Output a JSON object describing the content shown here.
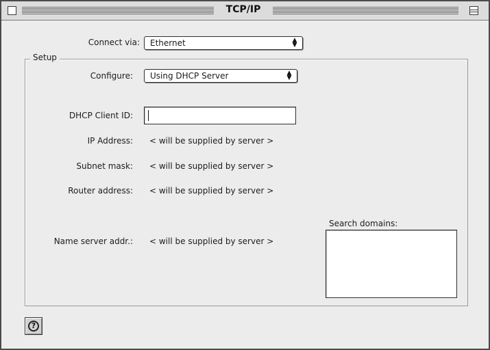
{
  "window": {
    "title": "TCP/IP"
  },
  "connect": {
    "label": "Connect via:",
    "value": "Ethernet"
  },
  "setup": {
    "group_label": "Setup",
    "configure_label": "Configure:",
    "configure_value": "Using DHCP Server",
    "dhcp_client_id_label": "DHCP Client ID:",
    "dhcp_client_id_value": "",
    "ip_address_label": "IP Address:",
    "ip_address_value": "< will be supplied by server >",
    "subnet_mask_label": "Subnet mask:",
    "subnet_mask_value": "< will be supplied by server >",
    "router_address_label": "Router address:",
    "router_address_value": "< will be supplied by server >",
    "name_server_label": "Name server addr.:",
    "name_server_value": "< will be supplied by server >",
    "search_domains_label": "Search domains:",
    "search_domains_value": ""
  },
  "help": {
    "glyph": "?"
  },
  "icons": {
    "popup_arrow": "up-down-arrows-icon",
    "help": "question-mark-icon"
  }
}
